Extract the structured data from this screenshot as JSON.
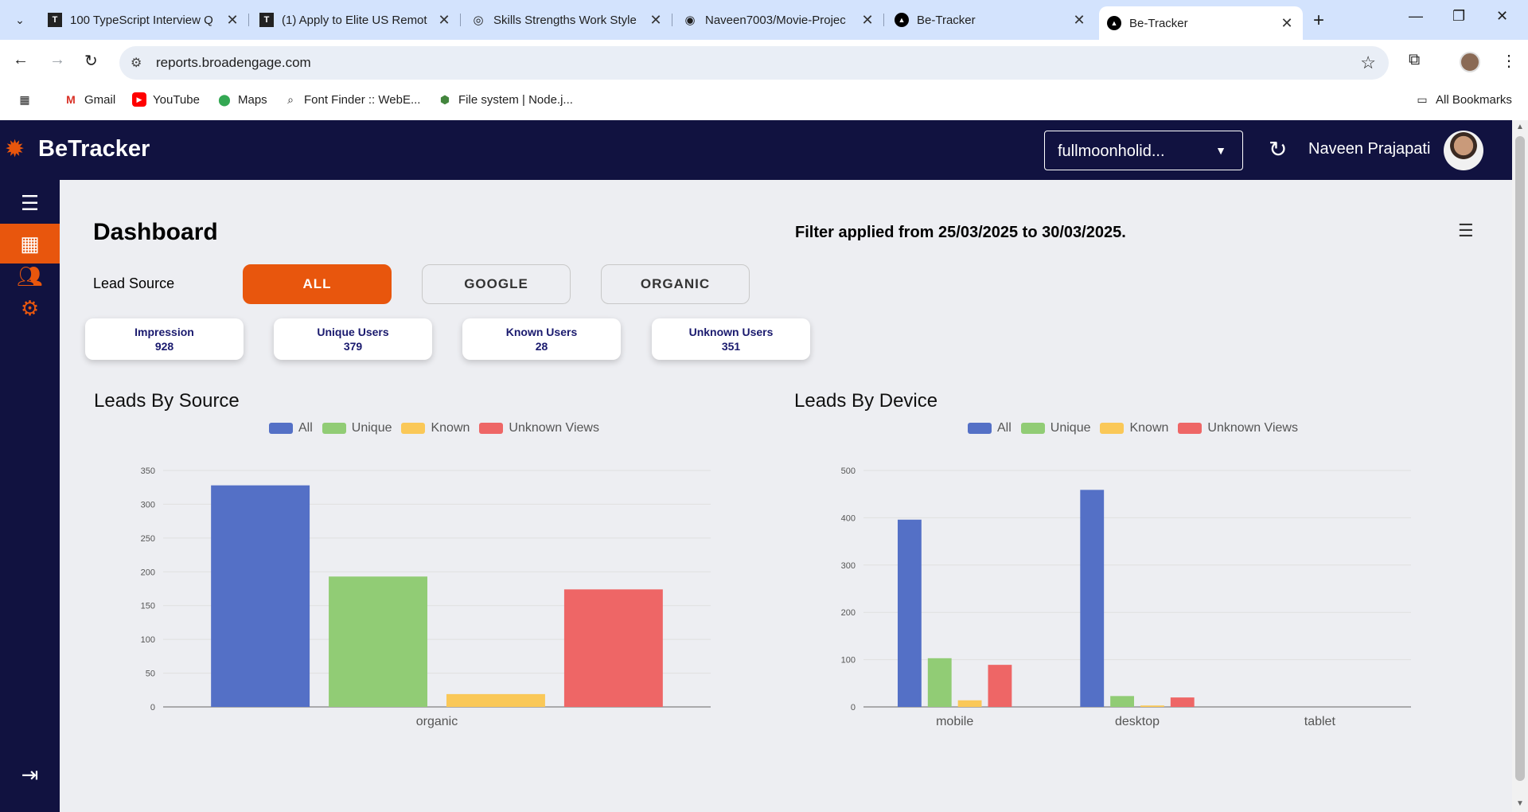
{
  "browser": {
    "tabs": [
      {
        "title": "100 TypeScript Interview Q",
        "fav": "T"
      },
      {
        "title": "(1) Apply to Elite US Remot",
        "fav": "T"
      },
      {
        "title": "Skills Strengths Work Style",
        "fav": "◎"
      },
      {
        "title": "Naveen7003/Movie-Projec",
        "fav": "◉"
      },
      {
        "title": "Be-Tracker",
        "fav": "▲"
      },
      {
        "title": "Be-Tracker",
        "fav": "▲"
      }
    ],
    "url": "reports.broadengage.com",
    "bookmarks": [
      "Gmail",
      "YouTube",
      "Maps",
      "Font Finder :: WebE...",
      "File system | Node.j..."
    ],
    "all_bookmarks": "All Bookmarks"
  },
  "app": {
    "brand": "BeTracker",
    "account": "fullmoonholid...",
    "user_name": "Naveen Prajapati",
    "page_title": "Dashboard",
    "filter_text": "Filter applied from 25/03/2025 to 30/03/2025.",
    "lead_source_label": "Lead Source",
    "sources": [
      "ALL",
      "GOOGLE",
      "ORGANIC"
    ],
    "active_source": "ALL",
    "stats": [
      {
        "label": "Impression",
        "value": "928"
      },
      {
        "label": "Unique Users",
        "value": "379"
      },
      {
        "label": "Known Users",
        "value": "28"
      },
      {
        "label": "Unknown Users",
        "value": "351"
      }
    ],
    "legend": [
      "All",
      "Unique",
      "Known",
      "Unknown Views"
    ]
  },
  "colors": {
    "accent": "#e8560d",
    "nav": "#111240",
    "all": "#5470c6",
    "unique": "#91cc75",
    "known": "#fac858",
    "unknown": "#ee6666"
  },
  "chart_data": [
    {
      "type": "bar",
      "title": "Leads By Source",
      "categories": [
        "organic"
      ],
      "series": [
        {
          "name": "All",
          "values": [
            328
          ]
        },
        {
          "name": "Unique",
          "values": [
            193
          ]
        },
        {
          "name": "Known",
          "values": [
            19
          ]
        },
        {
          "name": "Unknown Views",
          "values": [
            174
          ]
        }
      ],
      "yticks": [
        0,
        50,
        100,
        150,
        200,
        250,
        300,
        350
      ],
      "ylim": [
        0,
        350
      ],
      "legend": "top-center",
      "grid": true
    },
    {
      "type": "bar",
      "title": "Leads By Device",
      "categories": [
        "mobile",
        "desktop",
        "tablet"
      ],
      "series": [
        {
          "name": "All",
          "values": [
            396,
            459,
            0
          ]
        },
        {
          "name": "Unique",
          "values": [
            103,
            23,
            0
          ]
        },
        {
          "name": "Known",
          "values": [
            14,
            3,
            0
          ]
        },
        {
          "name": "Unknown Views",
          "values": [
            89,
            20,
            0
          ]
        }
      ],
      "yticks": [
        0,
        100,
        200,
        300,
        400,
        500
      ],
      "ylim": [
        0,
        500
      ],
      "legend": "top-center",
      "grid": true
    }
  ]
}
